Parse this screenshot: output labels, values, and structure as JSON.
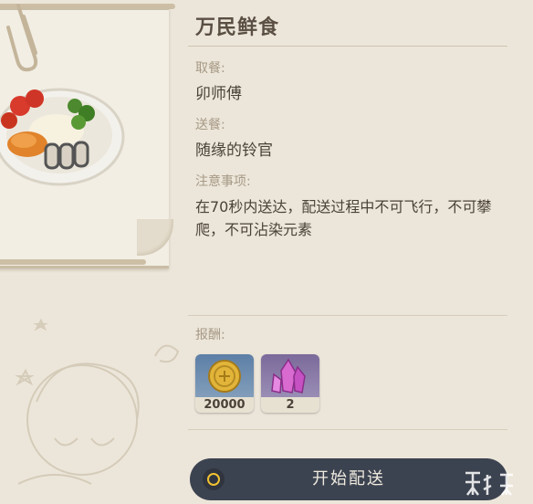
{
  "commission": {
    "title": "万民鲜食",
    "pickup_label": "取餐:",
    "pickup_value": "卯师傅",
    "delivery_label": "送餐:",
    "delivery_value": "随缘的铃官",
    "notes_label": "注意事项:",
    "notes_text": "在70秒内送达，配送过程中不可飞行，不可攀爬，不可沾染元素"
  },
  "rewards": {
    "label": "报酬:",
    "items": [
      {
        "icon": "mora-coin-icon",
        "count": "20000"
      },
      {
        "icon": "crystal-icon",
        "count": "2"
      }
    ]
  },
  "actions": {
    "start_label": "开始配送"
  },
  "colors": {
    "background": "#ece6da",
    "button": "#3c4350",
    "button_ring": "#f1c232",
    "title": "#5a4f42"
  }
}
